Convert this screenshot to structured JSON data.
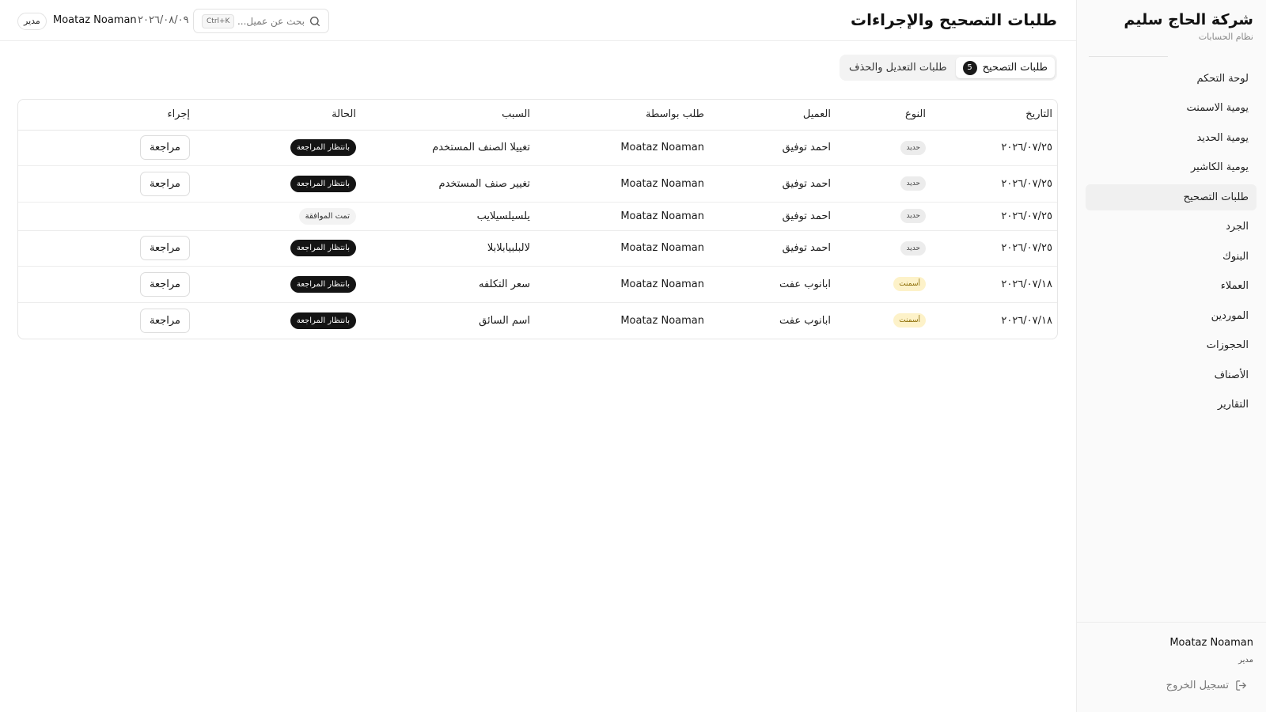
{
  "sidebar": {
    "brand_title": "شركة الحاج سليم",
    "brand_subtitle": "نظام الحسابات",
    "items": [
      {
        "label": "لوحة التحكم"
      },
      {
        "label": "يومية الاسمنت"
      },
      {
        "label": "يومية الحديد"
      },
      {
        "label": "يومية الكاشير"
      },
      {
        "label": "طلبات التصحيح"
      },
      {
        "label": "الجرد"
      },
      {
        "label": "البنوك"
      },
      {
        "label": "العملاء"
      },
      {
        "label": "الموردين"
      },
      {
        "label": "الحجوزات"
      },
      {
        "label": "الأصناف"
      },
      {
        "label": "التقارير"
      }
    ],
    "active_item": "طلبات التصحيح",
    "user_name": "Moataz Noaman",
    "user_role": "مدير",
    "logout_label": "تسجيل الخروج"
  },
  "header": {
    "title": "طلبات التصحيح والإجراءات",
    "search_placeholder": "بحث عن عميل...",
    "search_shortcut": "Ctrl+K",
    "date": "٢٠٢٦/٠٨/٠٩",
    "user_name": "Moataz Noaman",
    "user_role": "مدير"
  },
  "tabs": [
    {
      "label": "طلبات التصحيح",
      "count": "5",
      "active": true
    },
    {
      "label": "طلبات التعديل والحذف",
      "active": false
    }
  ],
  "table": {
    "columns": [
      "التاريخ",
      "النوع",
      "العميل",
      "طلب بواسطة",
      "السبب",
      "الحالة",
      "إجراء"
    ],
    "rows": [
      {
        "date": "٢٠٢٦/٠٧/٢٥",
        "type": "حديد",
        "customer": "احمد توفيق",
        "requested_by": "Moataz Noaman",
        "reason": "تغييلا الصنف المستخدم",
        "status": "بانتظار المراجعة",
        "action": "مراجعة"
      },
      {
        "date": "٢٠٢٦/٠٧/٢٥",
        "type": "حديد",
        "customer": "احمد توفيق",
        "requested_by": "Moataz Noaman",
        "reason": "تغيير صنف المستخدم",
        "status": "بانتظار المراجعة",
        "action": "مراجعة"
      },
      {
        "date": "٢٠٢٦/٠٧/٢٥",
        "type": "حديد",
        "customer": "احمد توفيق",
        "requested_by": "Moataz Noaman",
        "reason": "يلسيلسيلايب",
        "status": "تمت الموافقة",
        "action": ""
      },
      {
        "date": "٢٠٢٦/٠٧/٢٥",
        "type": "حديد",
        "customer": "احمد توفيق",
        "requested_by": "Moataz Noaman",
        "reason": "لالبلبيابلابلا",
        "status": "بانتظار المراجعة",
        "action": "مراجعة"
      },
      {
        "date": "٢٠٢٦/٠٧/١٨",
        "type": "أسمنت",
        "customer": "ابانوب عفت",
        "requested_by": "Moataz Noaman",
        "reason": "سعر التكلفه",
        "status": "بانتظار المراجعة",
        "action": "مراجعة"
      },
      {
        "date": "٢٠٢٦/٠٧/١٨",
        "type": "أسمنت",
        "customer": "ابانوب عفت",
        "requested_by": "Moataz Noaman",
        "reason": "اسم السائق",
        "status": "بانتظار المراجعة",
        "action": "مراجعة"
      }
    ]
  },
  "colors": {
    "accent": "#141414",
    "cement_badge_bg": "#fdf2c9",
    "iron_badge_bg": "#ececec",
    "sidebar_bg": "#fafafa"
  },
  "icons": {
    "search": "search-icon",
    "logout": "logout-icon"
  }
}
